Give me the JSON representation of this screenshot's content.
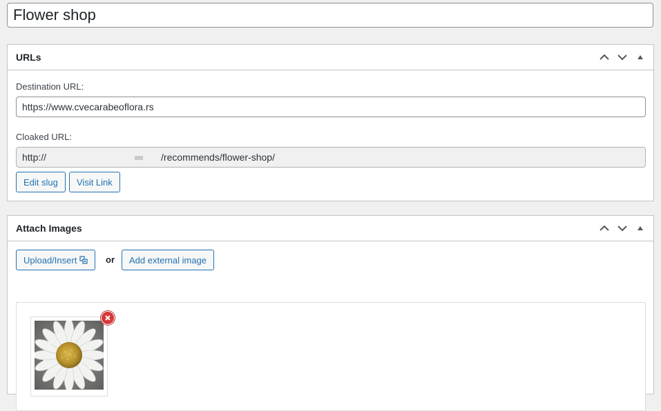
{
  "post": {
    "title": "Flower shop"
  },
  "urls_box": {
    "title": "URLs",
    "destination_label": "Destination URL:",
    "destination_value": "https://www.cvecarabeoflora.rs",
    "cloaked_label": "Cloaked URL:",
    "cloaked_prefix": "http://",
    "cloaked_suffix": "/recommends/flower-shop/",
    "edit_slug_label": "Edit slug",
    "visit_link_label": "Visit Link"
  },
  "images_box": {
    "title": "Attach Images",
    "upload_label": "Upload/Insert",
    "or_label": "or",
    "add_external_label": "Add external image"
  },
  "icons": {
    "move_up": "chevron-up-icon",
    "move_down": "chevron-down-icon",
    "toggle": "triangle-up-icon",
    "upload": "media-icon",
    "remove": "remove-x-icon"
  },
  "colors": {
    "accent": "#2271b1",
    "remove": "#d63638",
    "background": "#f0f0f1"
  }
}
